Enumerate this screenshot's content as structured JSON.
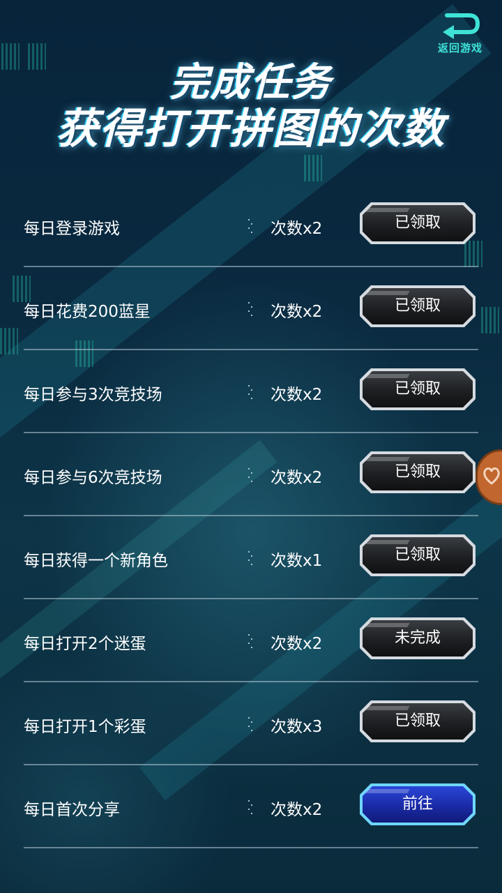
{
  "header": {
    "back_label": "返回游戏",
    "title_line1": "完成任务",
    "title_line2": "获得打开拼图的次数"
  },
  "tasks": [
    {
      "name": "每日登录游戏",
      "reward": "次数x2",
      "button": "已领取",
      "state": "claimed"
    },
    {
      "name": "每日花费200蓝星",
      "reward": "次数x2",
      "button": "已领取",
      "state": "claimed"
    },
    {
      "name": "每日参与3次竞技场",
      "reward": "次数x2",
      "button": "已领取",
      "state": "claimed"
    },
    {
      "name": "每日参与6次竞技场",
      "reward": "次数x2",
      "button": "已领取",
      "state": "claimed"
    },
    {
      "name": "每日获得一个新角色",
      "reward": "次数x1",
      "button": "已领取",
      "state": "claimed"
    },
    {
      "name": "每日打开2个迷蛋",
      "reward": "次数x2",
      "button": "未完成",
      "state": "incomplete"
    },
    {
      "name": "每日打开1个彩蛋",
      "reward": "次数x3",
      "button": "已领取",
      "state": "claimed"
    },
    {
      "name": "每日首次分享",
      "reward": "次数x2",
      "button": "前往",
      "state": "go"
    }
  ],
  "icons": {
    "back": "return-arrow-icon",
    "side_badge": "heart-badge-icon"
  },
  "colors": {
    "accent": "#3fe3d6",
    "go_button": "#1a2aa6",
    "claimed_button": "#1d1f22",
    "side_badge": "#c0662e"
  }
}
